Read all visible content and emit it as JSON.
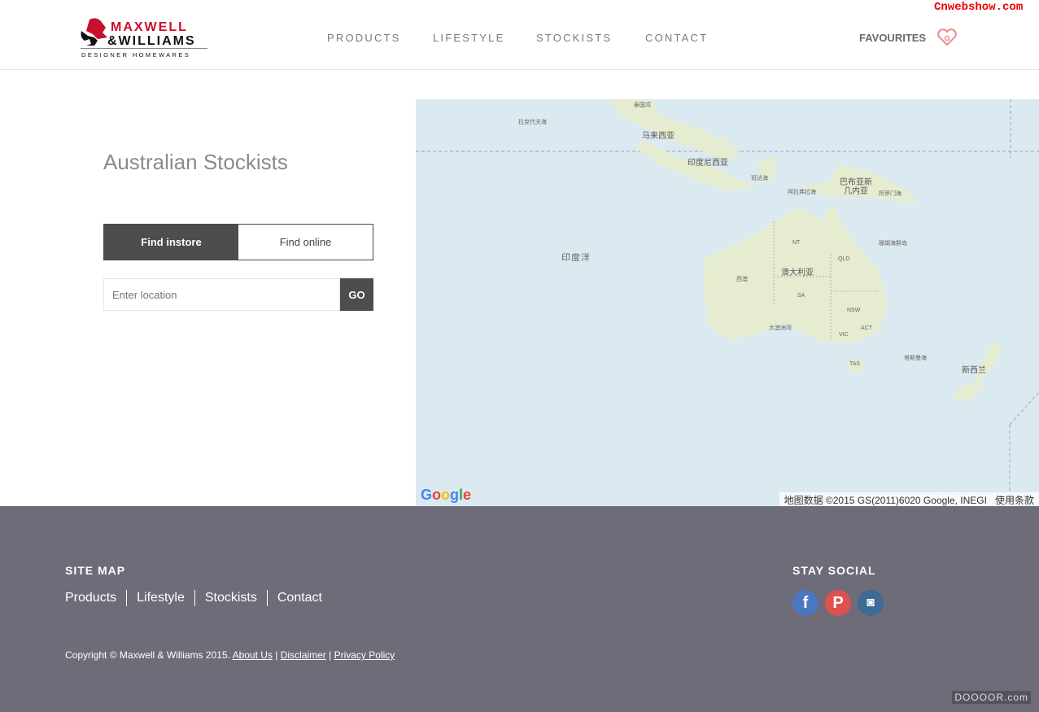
{
  "watermark_top": "Cnwebshow.com",
  "watermark_bottom": "DOOOOR.com",
  "logo": {
    "line1": "MAXWELL",
    "line2": "&WILLIAMS",
    "line3": "DESIGNER HOMEWARES",
    "brand_color": "#c8102e"
  },
  "nav": [
    "PRODUCTS",
    "LIFESTYLE",
    "STOCKISTS",
    "CONTACT"
  ],
  "favourites": "FAVOURITES",
  "page_title": "Australian Stockists",
  "tabs": {
    "instore": "Find instore",
    "online": "Find online"
  },
  "search": {
    "placeholder": "Enter location",
    "go": "GO"
  },
  "map": {
    "labels": [
      "泰国湾",
      "拉克代夫海",
      "马来西亚",
      "印度尼西亚",
      "班达海",
      "巴布亚新",
      "几内亚",
      "阿拉弗拉海",
      "所罗门海",
      "珊瑚海群岛",
      "印度洋",
      "澳大利亚",
      "西澳",
      "NT",
      "QLD",
      "SA",
      "NSW",
      "ACT",
      "VIC",
      "大澳洲湾",
      "TAS",
      "塔斯曼海",
      "新西兰"
    ],
    "google": "Google",
    "attribution": "地图数据 ©2015 GS(2011)6020 Google, INEGI",
    "terms": "使用条款"
  },
  "footer": {
    "sitemap_title": "SITE MAP",
    "links": [
      "Products",
      "Lifestyle",
      "Stockists",
      "Contact"
    ],
    "social_title": "STAY SOCIAL",
    "social": [
      {
        "icon": "facebook-icon",
        "glyph": "f",
        "color": "#4a77be"
      },
      {
        "icon": "pinterest-icon",
        "glyph": "P",
        "color": "#e0504f"
      },
      {
        "icon": "instagram-icon",
        "glyph": "◙",
        "color": "#3b6b96"
      }
    ],
    "copyright": "Copyright © Maxwell & Williams 2015.",
    "about": "About Us",
    "sep": "|",
    "disclaimer": "Disclaimer",
    "privacy": "Privacy Policy"
  }
}
